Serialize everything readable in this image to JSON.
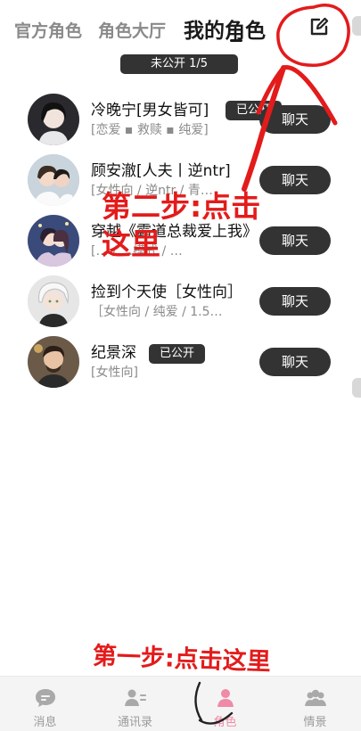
{
  "tabs": {
    "official": "官方角色",
    "hall": "角色大厅",
    "mine": "我的角色"
  },
  "unpublished": "未公开 1/5",
  "roles": [
    {
      "name": "冷晚宁[男女皆可]",
      "tags": "[恋爱 ▪ 救赎 ▪ 纯爱]",
      "badge": "已公开",
      "chat": "聊天"
    },
    {
      "name": "顾安澈[人夫丨逆ntr]",
      "tags": "[女性向 / 逆ntr / 青…",
      "badge": "",
      "chat": "聊天"
    },
    {
      "name": "穿越《霸道总裁爱上我》",
      "tags": "[… / …模式 / …",
      "badge": "",
      "chat": "聊天"
    },
    {
      "name": "捡到个天使［女性向］",
      "tags": "［女性向 / 纯爱 / 1.5…",
      "badge": "",
      "chat": "聊天"
    },
    {
      "name": "纪景深",
      "tags": "[女性向]",
      "badge": "已公开",
      "chat": "聊天"
    }
  ],
  "nav": {
    "messages": "消息",
    "contacts": "通讯录",
    "roles": "角色",
    "romance": "情景"
  },
  "annotations": {
    "step2_line1": "第二步:点击",
    "step2_line2": "这里",
    "step1": "第一步:点击这里"
  },
  "colors": {
    "dark_button": "#333333",
    "active_nav": "#f08aa6",
    "annotation_red": "#e31b1b"
  },
  "icons": {
    "edit": "edit-icon",
    "messages": "chat-bubble-icon",
    "contacts": "contacts-icon",
    "roles": "person-icon",
    "romance": "group-icon"
  }
}
